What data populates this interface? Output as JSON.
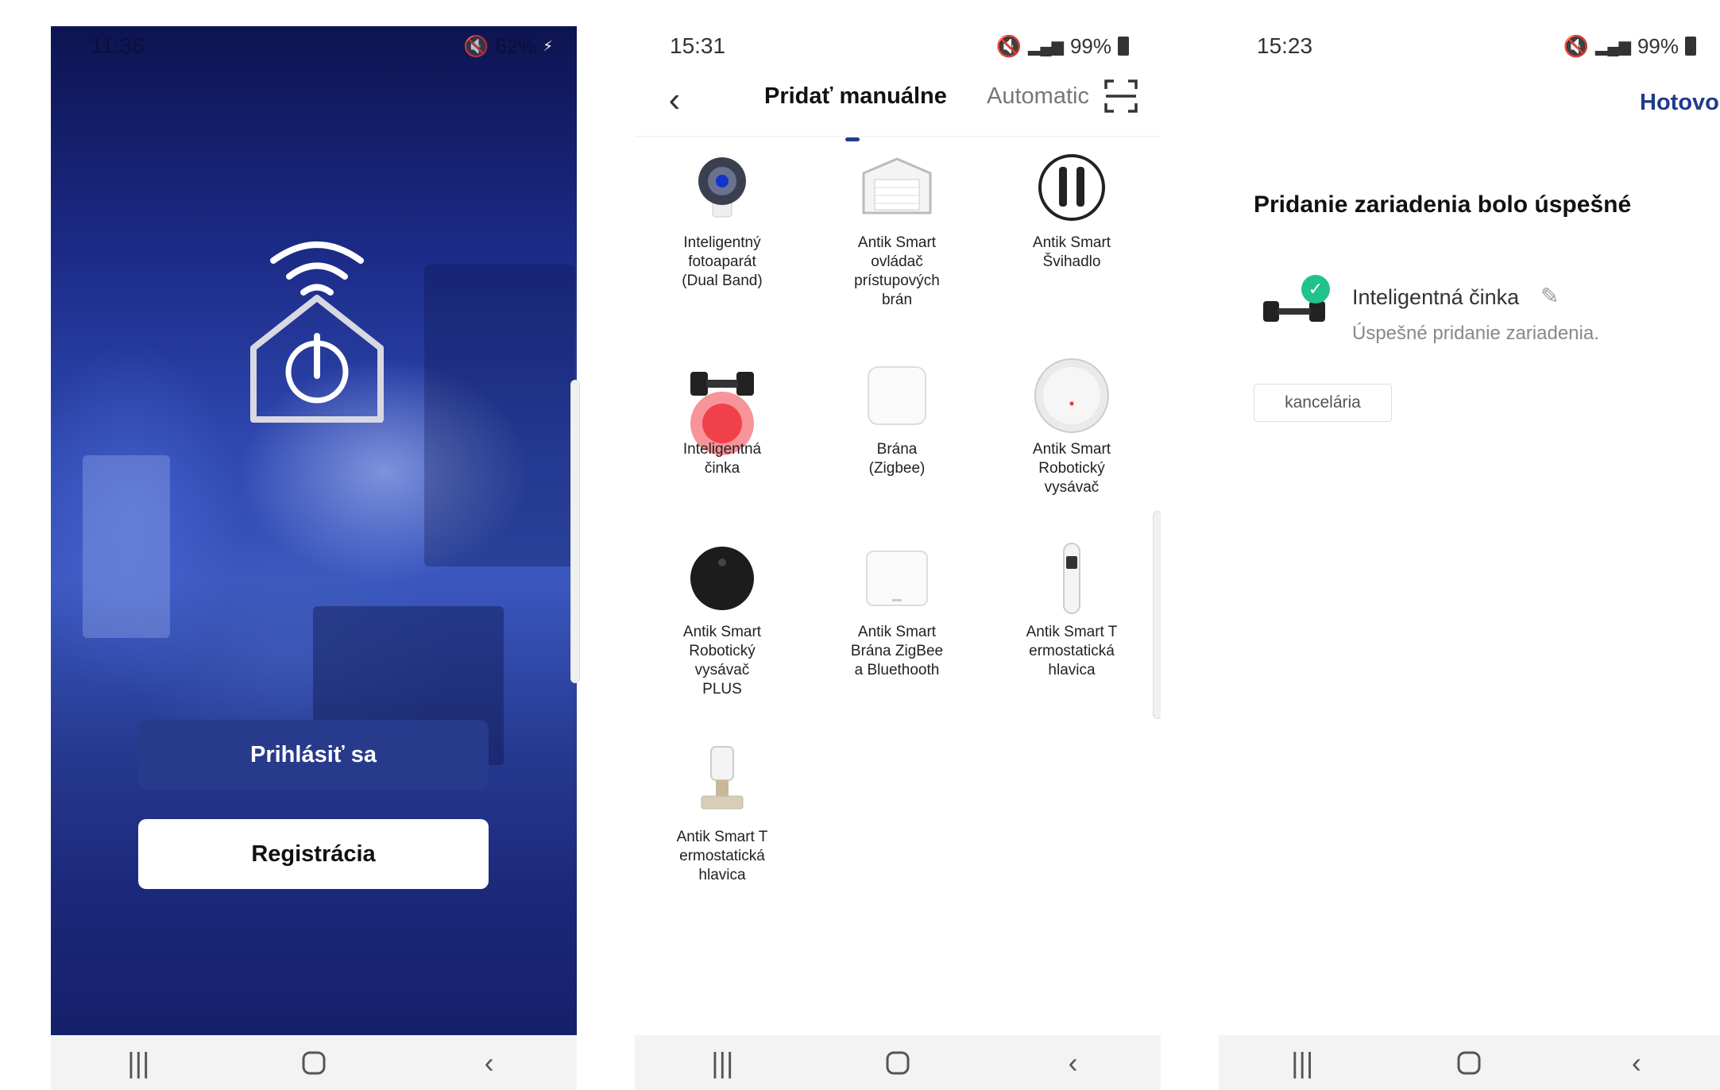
{
  "screen1": {
    "status": {
      "time": "11:36",
      "battery": "62%"
    },
    "buttons": {
      "login": "Prihlásiť sa",
      "register": "Registrácia"
    }
  },
  "screen2": {
    "status": {
      "time": "15:31",
      "battery": "99%"
    },
    "tabs": {
      "manual": "Pridať manuálne",
      "auto": "Automatic"
    },
    "devices": [
      {
        "label": "Inteligentný\nfotoaparát\n(Dual Band)",
        "icon": "camera-icon"
      },
      {
        "label": "Antik Smart\novládač\nprístupových\nbrán",
        "icon": "gate-controller-icon"
      },
      {
        "label": "Antik Smart\nŠvihadlo",
        "icon": "jump-rope-icon"
      },
      {
        "label": "Inteligentná\nčinka",
        "icon": "dumbbell-icon"
      },
      {
        "label": "Brána\n(Zigbee)",
        "icon": "zigbee-gateway-icon"
      },
      {
        "label": "Antik Smart\nRobotický\nvysávač",
        "icon": "robot-vacuum-white-icon"
      },
      {
        "label": "Antik Smart\nRobotický\nvysávač\nPLUS",
        "icon": "robot-vacuum-black-icon"
      },
      {
        "label": "Antik Smart\nBrána ZigBee\na Bluethooth",
        "icon": "zigbee-bluetooth-gateway-icon"
      },
      {
        "label": "Antik Smart T\nermostatická\nhlavica",
        "icon": "thermostat-head-icon"
      },
      {
        "label": "Antik Smart T\nermostatická\nhlavica",
        "icon": "thermostat-valve-icon"
      }
    ]
  },
  "screen3": {
    "status": {
      "time": "15:23",
      "battery": "99%"
    },
    "done": "Hotovo",
    "title": "Pridanie zariadenia bolo úspešné",
    "device_name": "Inteligentná činka",
    "device_subtitle": "Úspešné pridanie zariadenia.",
    "room": "kancelária"
  },
  "colors": {
    "accent": "#1f3b8c",
    "login_button": "#283a8c",
    "success": "#21c38a"
  }
}
